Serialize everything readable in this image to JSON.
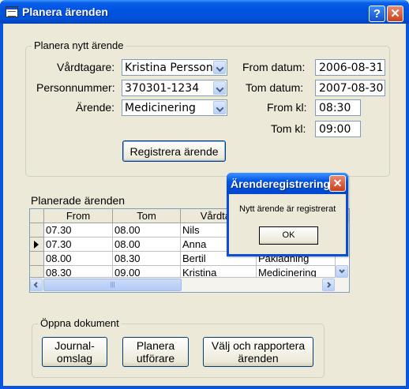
{
  "window": {
    "title": "Planera ärenden",
    "help": "?",
    "close": "✕"
  },
  "plan": {
    "legend": "Planera nytt ärende",
    "vardtagare_label": "Vårdtagare:",
    "vardtagare_value": "Kristina Persson",
    "personnummer_label": "Personnummer:",
    "personnummer_value": "370301-1234",
    "arende_label": "Ärende:",
    "arende_value": "Medicinering",
    "from_datum_label": "From datum:",
    "from_datum_value": "2006-08-31",
    "tom_datum_label": "Tom datum:",
    "tom_datum_value": "2007-08-30",
    "from_kl_label": "From kl:",
    "from_kl_value": "08:30",
    "tom_kl_label": "Tom kl:",
    "tom_kl_value": "09:00",
    "register_button": "Registrera ärende"
  },
  "planned": {
    "label": "Planerade ärenden",
    "columns": [
      "From",
      "Tom",
      "Vårdtag"
    ],
    "rows": [
      {
        "from": "07.30",
        "tom": "08.00",
        "vardtagare": "Nils",
        "arende": ""
      },
      {
        "from": "07.30",
        "tom": "08.00",
        "vardtagare": "Anna",
        "arende": ""
      },
      {
        "from": "08.00",
        "tom": "08.30",
        "vardtagare": "Bertil",
        "arende": "Påklädning"
      },
      {
        "from": "08.30",
        "tom": "09.00",
        "vardtagare": "Kristina",
        "arende": "Medicinering"
      }
    ],
    "scroll_thumb": "|||"
  },
  "docs": {
    "legend": "Öppna dokument",
    "journal_line1": "Journal-",
    "journal_line2": "omslag",
    "planera_line1": "Planera",
    "planera_line2": "utförare",
    "valj_line1": "Välj och rapportera",
    "valj_line2": "ärenden"
  },
  "dialog": {
    "title": "Ärenderegistrering",
    "close": "✕",
    "message": "Nytt ärende är registrerat",
    "ok": "OK"
  }
}
